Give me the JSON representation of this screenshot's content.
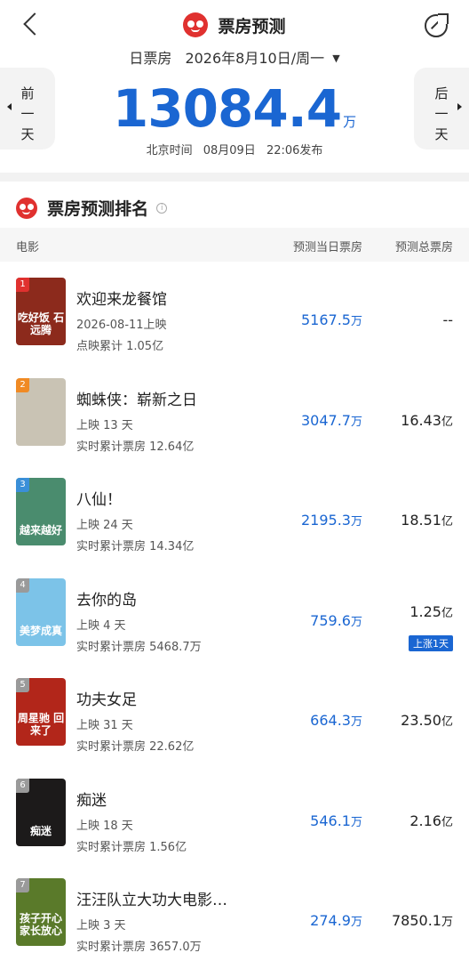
{
  "header": {
    "title": "票房预测",
    "date": "2026年8月10日/周一",
    "date_prefix": "日票房",
    "caret": "▼",
    "prev_label": "前一天",
    "next_label": "后一天"
  },
  "summary": {
    "total": "13084.4",
    "unit": "万",
    "time_prefix": "北京时间",
    "time_date": "08月09日",
    "time_clock": "22:06发布"
  },
  "section": {
    "title": "票房预测排名",
    "info_glyph": "i",
    "col_movie": "电影",
    "col_today": "预测当日票房",
    "col_total": "预测总票房"
  },
  "movies": [
    {
      "rank": "1",
      "title": "欢迎来龙餐馆",
      "line1": "2026-08-11上映",
      "line2": "点映累计 1.05亿",
      "today": "5167.5",
      "today_unit": "万",
      "total": "--",
      "total_unit": "",
      "poster_text": "吃好饭 石远腾",
      "rank_color": "#e0312f",
      "poster_bg": "#8c2a1c"
    },
    {
      "rank": "2",
      "title": "蜘蛛侠：崭新之日",
      "line1": "上映 13 天",
      "line2": "实时累计票房 12.64亿",
      "today": "3047.7",
      "today_unit": "万",
      "total": "16.43",
      "total_unit": "亿",
      "poster_text": "",
      "rank_color": "#f08a24",
      "poster_bg": "#c9c3b4"
    },
    {
      "rank": "3",
      "title": "八仙！",
      "line1": "上映 24 天",
      "line2": "实时累计票房 14.34亿",
      "today": "2195.3",
      "today_unit": "万",
      "total": "18.51",
      "total_unit": "亿",
      "poster_text": "越来越好",
      "rank_color": "#3a8fd8",
      "poster_bg": "#4a8c6e"
    },
    {
      "rank": "4",
      "title": "去你的岛",
      "line1": "上映 4 天",
      "line2": "实时累计票房 5468.7万",
      "today": "759.6",
      "today_unit": "万",
      "total": "1.25",
      "total_unit": "亿",
      "badge": "上涨1天",
      "poster_text": "美梦成真",
      "rank_color": "#9a9a9a",
      "poster_bg": "#7cc3e8"
    },
    {
      "rank": "5",
      "title": "功夫女足",
      "line1": "上映 31 天",
      "line2": "实时累计票房 22.62亿",
      "today": "664.3",
      "today_unit": "万",
      "total": "23.50",
      "total_unit": "亿",
      "poster_text": "周星驰 回来了",
      "rank_color": "#9a9a9a",
      "poster_bg": "#b2261a"
    },
    {
      "rank": "6",
      "title": "痴迷",
      "line1": "上映 18 天",
      "line2": "实时累计票房 1.56亿",
      "today": "546.1",
      "today_unit": "万",
      "total": "2.16",
      "total_unit": "亿",
      "poster_text": "痴迷",
      "rank_color": "#9a9a9a",
      "poster_bg": "#1c1a1a"
    },
    {
      "rank": "7",
      "title": "汪汪队立大功大电影…",
      "line1": "上映 3 天",
      "line2": "实时累计票房 3657.0万",
      "today": "274.9",
      "today_unit": "万",
      "total": "7850.1",
      "total_unit": "万",
      "poster_text": "孩子开心 家长放心",
      "rank_color": "#9a9a9a",
      "poster_bg": "#5a7a2a"
    }
  ]
}
